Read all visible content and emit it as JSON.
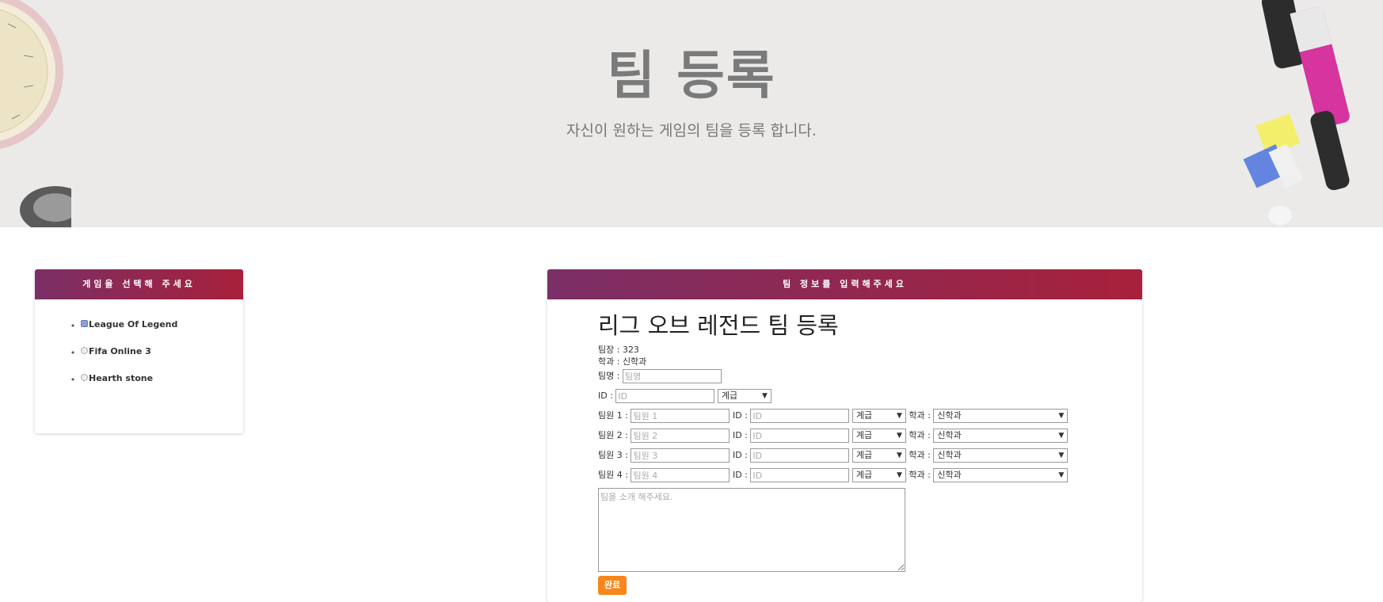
{
  "hero": {
    "title": "팀 등록",
    "subtitle": "자신이 원하는 게임의 팀을 등록 합니다."
  },
  "left_panel": {
    "header": "게임을 선택해 주세요",
    "games": [
      {
        "label": "League Of Legend",
        "selected": true
      },
      {
        "label": "Fifa Online 3",
        "selected": false
      },
      {
        "label": "Hearth stone",
        "selected": false
      }
    ]
  },
  "right_panel": {
    "header": "팀 정보를 입력해주세요",
    "form_title": "리그 오브 레전드 팀 등록",
    "leader_label": "팀장 : 323",
    "dept_label": "학과 : 신학과",
    "team_name_label": "팀명 :",
    "team_name_placeholder": "팀명",
    "id_label": "ID :",
    "id_placeholder": "ID",
    "tier_select": "계급",
    "members": [
      {
        "label": "팀원 1 :",
        "placeholder": "팀원 1",
        "id_label": "ID :",
        "id_placeholder": "ID",
        "tier": "계급",
        "dept_label": "학과 :",
        "dept": "신학과"
      },
      {
        "label": "팀원 2 :",
        "placeholder": "팀원 2",
        "id_label": "ID :",
        "id_placeholder": "ID",
        "tier": "계급",
        "dept_label": "학과 :",
        "dept": "신학과"
      },
      {
        "label": "팀원 3 :",
        "placeholder": "팀원 3",
        "id_label": "ID :",
        "id_placeholder": "ID",
        "tier": "계급",
        "dept_label": "학과 :",
        "dept": "신학과"
      },
      {
        "label": "팀원 4 :",
        "placeholder": "팀원 4",
        "id_label": "ID :",
        "id_placeholder": "ID",
        "tier": "계급",
        "dept_label": "학과 :",
        "dept": "신학과"
      }
    ],
    "intro_placeholder": "팀을 소개 해주세요.",
    "submit_label": "완료"
  },
  "colors": {
    "header_gradient_start": "#7b2f66",
    "header_gradient_end": "#a8213b",
    "submit_button": "#f7861c",
    "hero_background": "#ebeae8"
  }
}
